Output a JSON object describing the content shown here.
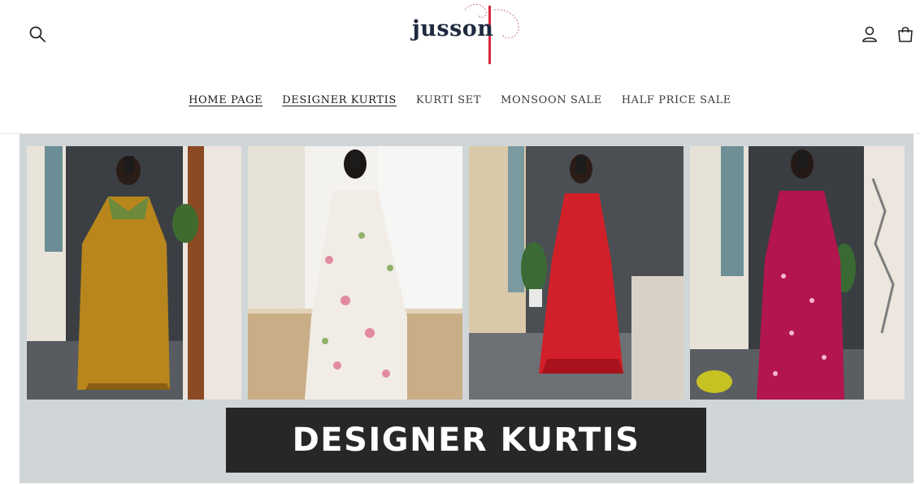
{
  "brand": {
    "logo_text": "jusson"
  },
  "header": {
    "search_icon": "search-icon",
    "account_icon": "user-icon",
    "cart_icon": "cart-icon"
  },
  "nav": {
    "items": [
      {
        "label": "HOME PAGE",
        "active": true
      },
      {
        "label": "DESIGNER KURTIS",
        "active": true
      },
      {
        "label": "KURTI SET",
        "active": false
      },
      {
        "label": "MONSOON SALE",
        "active": false
      },
      {
        "label": "HALF PRICE SALE",
        "active": false
      }
    ]
  },
  "banner": {
    "caption": "DESIGNER KURTIS",
    "photos": [
      {
        "dress_color": "#b8861c"
      },
      {
        "dress_color": "#f1ece6"
      },
      {
        "dress_color": "#d1202a"
      },
      {
        "dress_color": "#b3154e"
      }
    ]
  },
  "colors": {
    "banner_bg": "#d0d6d8",
    "caption_bg": "#272727",
    "logo_accent": "#d7263d",
    "text_dark": "#1f2a3f"
  }
}
